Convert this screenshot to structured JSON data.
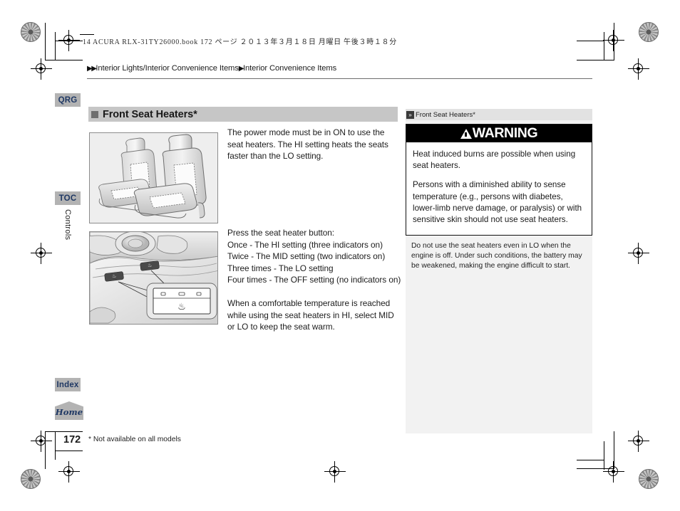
{
  "print_meta": {
    "text": "14 ACURA RLX-31TY26000.book  172 ページ  ２０１３年３月１８日  月曜日  午後３時１８分"
  },
  "breadcrumb": {
    "arrow1": "▶▶",
    "part1": "Interior Lights/Interior Convenience Items",
    "arrow2": "▶",
    "part2": "Interior Convenience Items"
  },
  "tabs": {
    "qrg": "QRG",
    "toc": "TOC",
    "index": "Index",
    "home": "Home",
    "chapter": "Controls"
  },
  "section": {
    "title": "Front Seat Heaters*"
  },
  "main": {
    "paragraph1": "The power mode must be in ON to use the seat heaters. The HI setting heats the seats faster than the LO setting.",
    "press_intro": "Press the seat heater button:",
    "press_steps": [
      "Once - The HI setting (three indicators on)",
      "Twice - The MID setting (two indicators on)",
      "Three times - The LO setting",
      "Four times - The OFF setting (no indicators on)"
    ],
    "paragraph2": "When a comfortable temperature is reached while using the seat heaters in HI, select MID or LO to keep the seat warm."
  },
  "figures": {
    "seats_caption": "Front seats with heating element areas",
    "console_caption": "Center console seat heater buttons with detail callout"
  },
  "side_note": {
    "marker": "»",
    "title": "Front Seat Heaters*"
  },
  "warning": {
    "heading": "WARNING",
    "paragraph1": "Heat induced burns are possible when using seat heaters.",
    "paragraph2": "Persons with a diminished ability to sense temperature (e.g., persons with diabetes, lower-limb nerve damage, or paralysis) or with sensitive skin should not use seat heaters."
  },
  "note": {
    "text": "Do not use the seat heaters even in LO when the engine is off. Under such conditions, the battery may be weakened, making the engine difficult to start."
  },
  "footer": {
    "page_number": "172",
    "footnote": "* Not available on all models"
  },
  "colors": {
    "tab_gray": "#b3b3b3",
    "tab_text": "#1f3864",
    "section_band": "#c6c6c6",
    "panel_gray": "#f2f2f2",
    "warning_bar": "#000000"
  }
}
